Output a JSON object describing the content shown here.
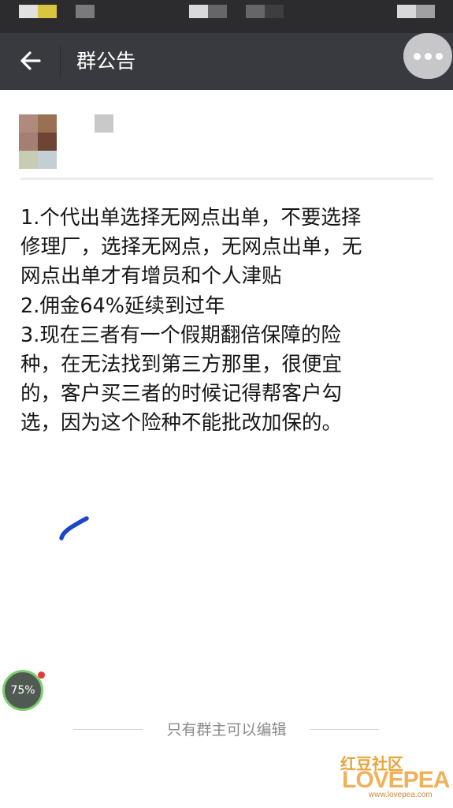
{
  "header": {
    "title": "群公告",
    "back_icon": "arrow-left-icon",
    "more_icon": "more-dots-icon",
    "background": "#393a3f"
  },
  "announcement": {
    "lines": [
      "1.个代出单选择无网点出单，不要选择",
      "修理厂，选择无网点，无网点出单，无",
      "网点出单才有增员和个人津贴",
      "2.佣金64%延续到过年",
      "3.现在三者有一个假期翻倍保障的险",
      "种，在无法找到第三方那里，很便宜",
      "的，客户买三者的时候记得帮客户勾",
      "选，因为这个险种不能批改加保的。"
    ]
  },
  "overlay": {
    "progress_badge": "75%",
    "progress_value": 0.75
  },
  "footer": {
    "note": "只有群主可以编辑"
  },
  "watermark": {
    "cn": "红豆社区",
    "en": "LOVEPEA",
    "url": "www.lovepea.com"
  }
}
